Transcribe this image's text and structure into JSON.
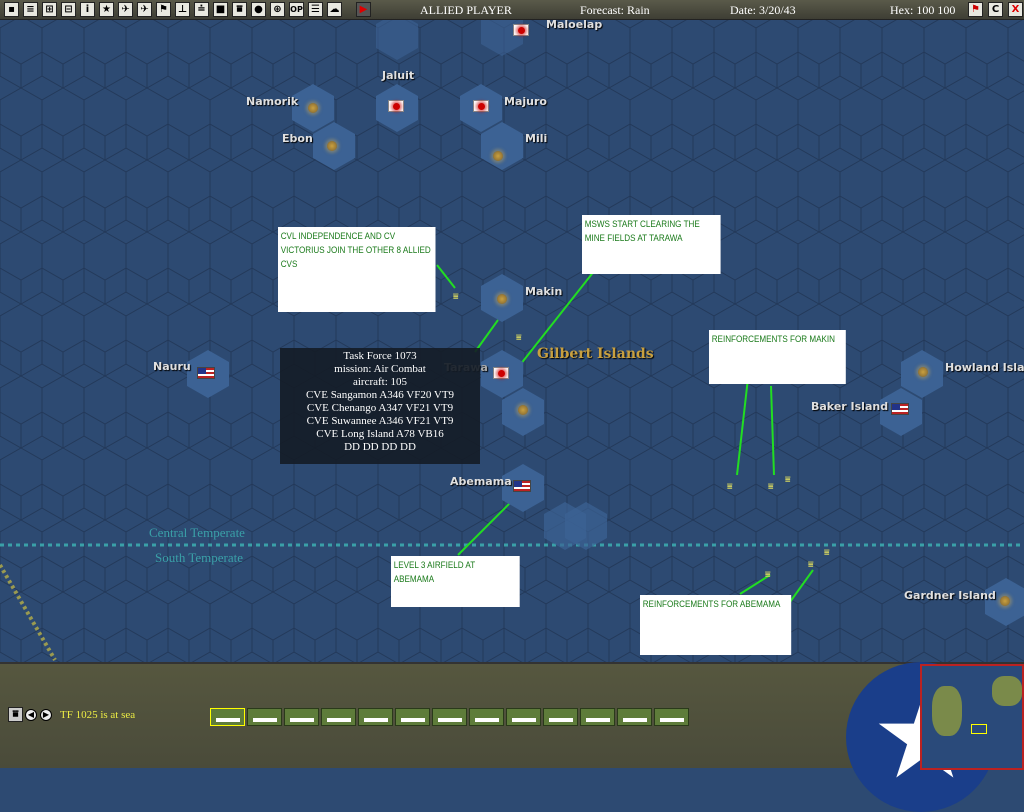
{
  "toolbar": {
    "icons": [
      "save-icon",
      "report-icon",
      "group-icon",
      "base-icon",
      "info-icon",
      "star-icon",
      "jp-air-icon",
      "allied-air-icon",
      "flag-icon",
      "ship-icon",
      "task-force-icon",
      "zone-icon",
      "convoy-icon",
      "globe-icon",
      "target-icon",
      "op-icon",
      "list-icon",
      "weather-icon",
      "end-turn-icon"
    ],
    "op_label": "OP",
    "player": "ALLIED PLAYER",
    "forecast": "Forecast: Rain",
    "date": "Date: 3/20/43",
    "hex": "Hex: 100 100",
    "right_buttons": [
      "flag-icon",
      "C",
      "X"
    ]
  },
  "map": {
    "places": [
      "Maloelap",
      "Jaluit",
      "Namorik",
      "Majuro",
      "Ebon",
      "Mili",
      "Makin",
      "Tarawa",
      "Nauru",
      "Baker Island",
      "Howland Island",
      "Abemama",
      "Gardner Island"
    ],
    "region": "Gilbert Islands",
    "zones": [
      "Central Temperate",
      "South Temperate"
    ],
    "notes": [
      "CVL INDEPENDENCE AND CV VICTORIUS JOIN THE OTHER 8 ALLIED CVs",
      "MSWs START CLEARING THE MINE FIELDS AT TARAWA",
      "REINFORCEMENTS FOR MAKIN",
      "LEVEL 3 AIRFIELD AT ABEMAMA",
      "REINFORCEMENTS FOR ABEMAMA"
    ],
    "tf_popup": [
      "Task Force 1073",
      "mission: Air Combat",
      "aircraft: 105",
      "CVE Sangamon  A346  VF20  VT9",
      "CVE Chenango  A347  VF21  VT9",
      "CVE Suwannee  A346  VF21  VT9",
      "CVE Long Island  A78  VB16",
      "DD DD DD DD"
    ]
  },
  "bottom": {
    "status": "TF 1025 is at sea",
    "ship_count": 13
  }
}
